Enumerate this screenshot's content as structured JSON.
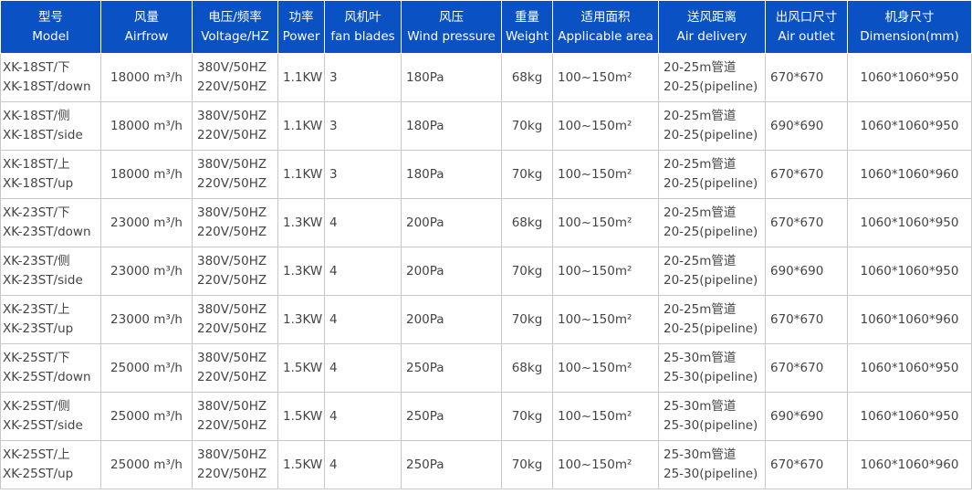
{
  "table": {
    "headers": [
      {
        "zh": "型号",
        "en": "Model"
      },
      {
        "zh": "风量",
        "en": "Airfrow"
      },
      {
        "zh": "电压/频率",
        "en": "Voltage/HZ"
      },
      {
        "zh": "功率",
        "en": "Power"
      },
      {
        "zh": "风机叶",
        "en": "fan blades"
      },
      {
        "zh": "风压",
        "en": "Wind pressure"
      },
      {
        "zh": "重量",
        "en": "Weight"
      },
      {
        "zh": "适用面积",
        "en": "Applicable area"
      },
      {
        "zh": "送风距离",
        "en": "Air delivery"
      },
      {
        "zh": "出风口尺寸",
        "en": "Air outlet"
      },
      {
        "zh": "机身尺寸",
        "en": "Dimension(mm)"
      }
    ],
    "rows": [
      {
        "model": [
          "XK-18ST/下",
          "XK-18ST/down"
        ],
        "airflow": "18000 m³/h",
        "voltage": [
          "380V/50HZ",
          "220V/50HZ"
        ],
        "power": "1.1KW",
        "blades": "3",
        "pressure": "180Pa",
        "weight": "68kg",
        "area": "100~150m²",
        "delivery": [
          "20-25m管道",
          "20-25(pipeline)"
        ],
        "outlet": "670*670",
        "dimension": "1060*1060*950"
      },
      {
        "model": [
          "XK-18ST/侧",
          "XK-18ST/side"
        ],
        "airflow": "18000 m³/h",
        "voltage": [
          "380V/50HZ",
          "220V/50HZ"
        ],
        "power": "1.1KW",
        "blades": "3",
        "pressure": "180Pa",
        "weight": "70kg",
        "area": "100~150m²",
        "delivery": [
          "20-25m管道",
          "20-25(pipeline)"
        ],
        "outlet": "690*690",
        "dimension": "1060*1060*950"
      },
      {
        "model": [
          "XK-18ST/上",
          "XK-18ST/up"
        ],
        "airflow": "18000 m³/h",
        "voltage": [
          "380V/50HZ",
          "220V/50HZ"
        ],
        "power": "1.1KW",
        "blades": "3",
        "pressure": "180Pa",
        "weight": "70kg",
        "area": "100~150m²",
        "delivery": [
          "20-25m管道",
          "20-25(pipeline)"
        ],
        "outlet": "670*670",
        "dimension": "1060*1060*960"
      },
      {
        "model": [
          "XK-23ST/下",
          "XK-23ST/down"
        ],
        "airflow": "23000 m³/h",
        "voltage": [
          "380V/50HZ",
          "220V/50HZ"
        ],
        "power": "1.3KW",
        "blades": "4",
        "pressure": "200Pa",
        "weight": "68kg",
        "area": "100~150m²",
        "delivery": [
          "20-25m管道",
          "20-25(pipeline)"
        ],
        "outlet": "670*670",
        "dimension": "1060*1060*950"
      },
      {
        "model": [
          "XK-23ST/侧",
          "XK-23ST/side"
        ],
        "airflow": "23000 m³/h",
        "voltage": [
          "380V/50HZ",
          "220V/50HZ"
        ],
        "power": "1.3KW",
        "blades": "4",
        "pressure": "200Pa",
        "weight": "70kg",
        "area": "100~150m²",
        "delivery": [
          "20-25m管道",
          "20-25(pipeline)"
        ],
        "outlet": "690*690",
        "dimension": "1060*1060*950"
      },
      {
        "model": [
          "XK-23ST/上",
          "XK-23ST/up"
        ],
        "airflow": "23000 m³/h",
        "voltage": [
          "380V/50HZ",
          "220V/50HZ"
        ],
        "power": "1.3KW",
        "blades": "4",
        "pressure": "200Pa",
        "weight": "70kg",
        "area": "100~150m²",
        "delivery": [
          "20-25m管道",
          "20-25(pipeline)"
        ],
        "outlet": "670*670",
        "dimension": "1060*1060*960"
      },
      {
        "model": [
          "XK-25ST/下",
          "XK-25ST/down"
        ],
        "airflow": "25000 m³/h",
        "voltage": [
          "380V/50HZ",
          "220V/50HZ"
        ],
        "power": "1.5KW",
        "blades": "4",
        "pressure": "250Pa",
        "weight": "68kg",
        "area": "100~150m²",
        "delivery": [
          "25-30m管道",
          "25-30(pipeline)"
        ],
        "outlet": "670*670",
        "dimension": "1060*1060*950"
      },
      {
        "model": [
          "XK-25ST/侧",
          "XK-25ST/side"
        ],
        "airflow": "25000 m³/h",
        "voltage": [
          "380V/50HZ",
          "220V/50HZ"
        ],
        "power": "1.5KW",
        "blades": "4",
        "pressure": "250Pa",
        "weight": "70kg",
        "area": "100~150m²",
        "delivery": [
          "25-30m管道",
          "25-30(pipeline)"
        ],
        "outlet": "690*690",
        "dimension": "1060*1060*950"
      },
      {
        "model": [
          "XK-25ST/上",
          "XK-25ST/up"
        ],
        "airflow": "25000 m³/h",
        "voltage": [
          "380V/50HZ",
          "220V/50HZ"
        ],
        "power": "1.5KW",
        "blades": "4",
        "pressure": "250Pa",
        "weight": "70kg",
        "area": "100~150m²",
        "delivery": [
          "25-30m管道",
          "25-30(pipeline)"
        ],
        "outlet": "670*670",
        "dimension": "1060*1060*960"
      }
    ]
  },
  "colors": {
    "header_bg": "#0a51c4",
    "header_text": "#ffffff",
    "cell_text": "#444444",
    "grid": "#c8c8c8"
  }
}
